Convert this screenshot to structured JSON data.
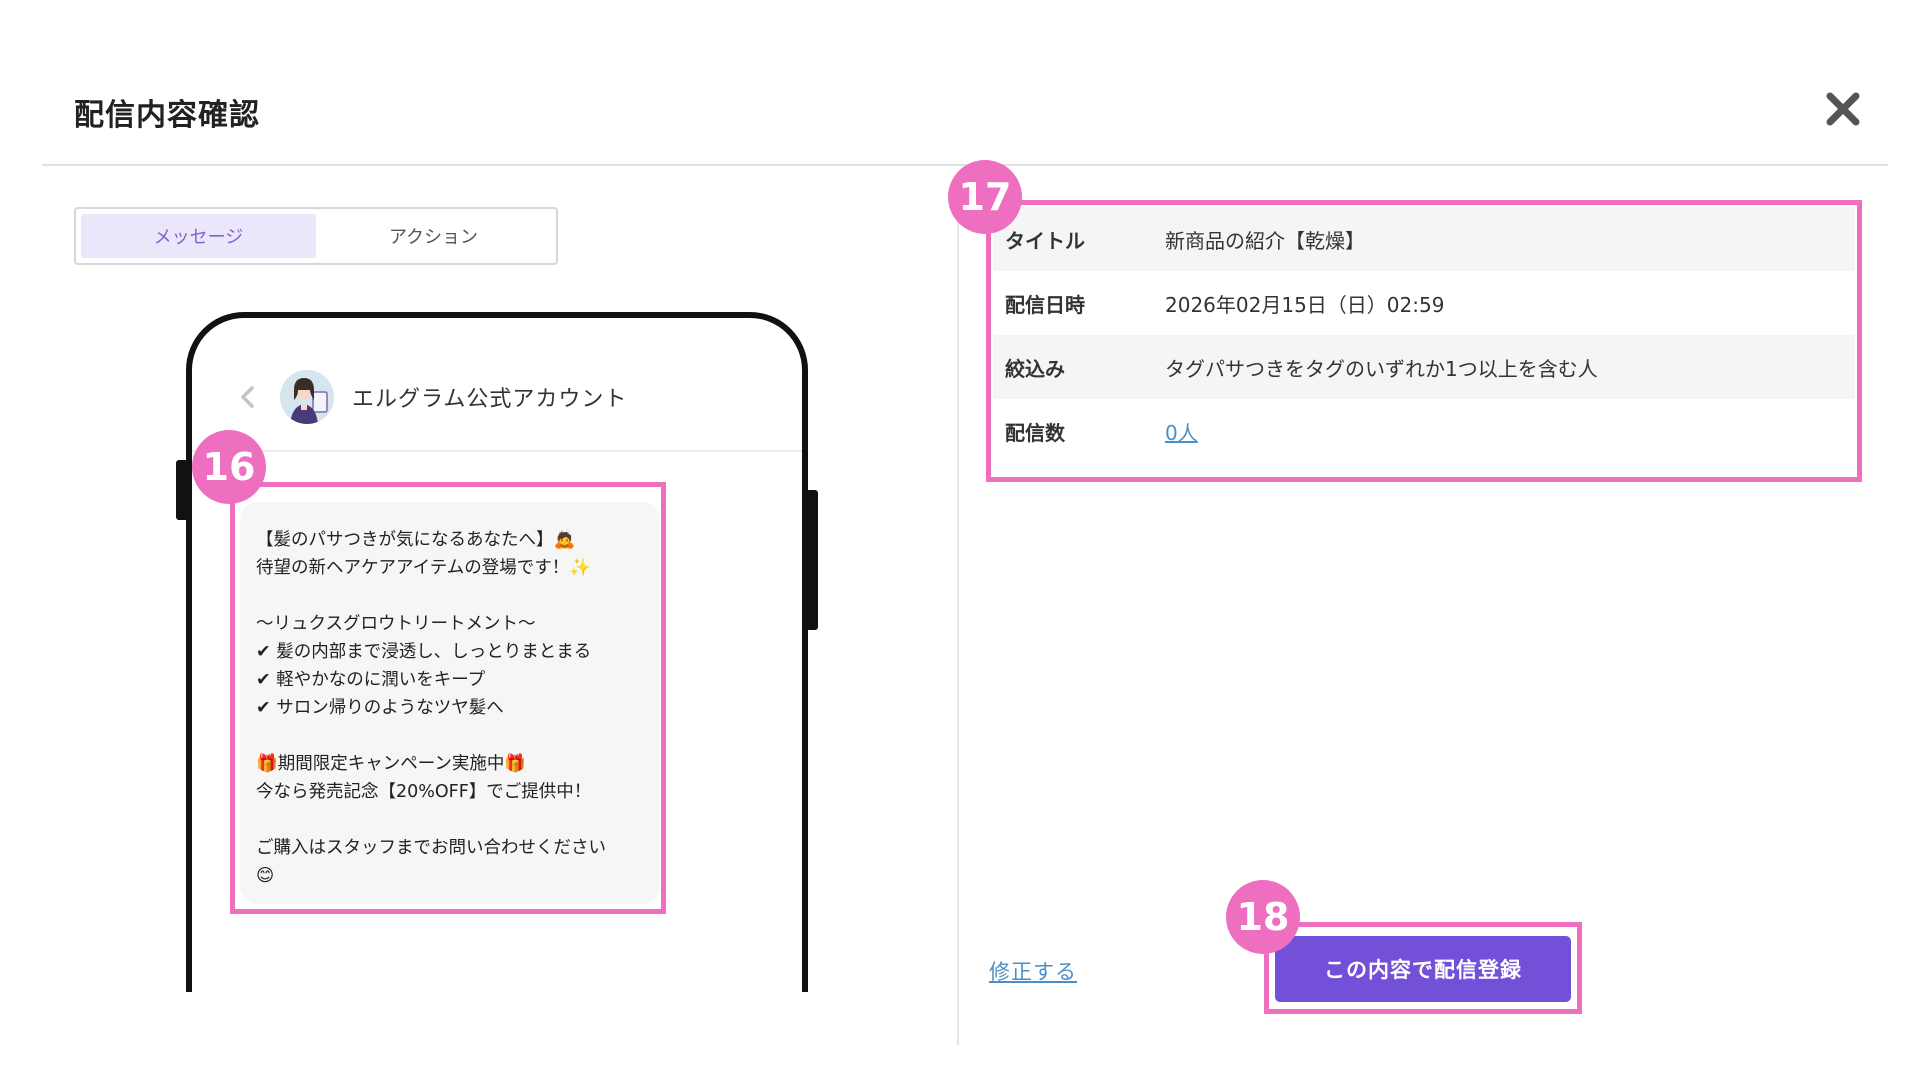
{
  "modal": {
    "title": "配信内容確認"
  },
  "tabs": [
    {
      "label": "メッセージ",
      "active": true
    },
    {
      "label": "アクション",
      "active": false
    }
  ],
  "phone": {
    "account_name": "エルグラム公式アカウント",
    "message_lines": [
      "【髪のパサつきが気になるあなたへ】🙇",
      "待望の新ヘアケアアイテムの登場です！✨",
      "",
      "〜リュクスグロウトリートメント〜",
      "✔ 髪の内部まで浸透し、しっとりまとまる",
      "✔ 軽やかなのに潤いをキープ",
      "✔ サロン帰りのようなツヤ髪へ",
      "",
      "🎁期間限定キャンペーン実施中🎁",
      "今なら発売記念【20%OFF】でご提供中！",
      "",
      "ご購入はスタッフまでお問い合わせください",
      "😊"
    ]
  },
  "info": {
    "rows": [
      {
        "label": "タイトル",
        "value": "新商品の紹介【乾燥】"
      },
      {
        "label": "配信日時",
        "value": "2026年02月15日（日）02:59"
      },
      {
        "label": "絞込み",
        "value": "タグパサつきをタグのいずれか1つ以上を含む人"
      },
      {
        "label": "配信数",
        "value": "0人"
      }
    ]
  },
  "actions": {
    "edit_label": "修正する",
    "submit_label": "この内容で配信登録"
  },
  "annotations": {
    "badge_16": "16",
    "badge_17": "17",
    "badge_18": "18"
  },
  "colors": {
    "accent_purple": "#7350d8",
    "highlight_pink": "#ee6fbf",
    "link_blue": "#4a8fc7",
    "tab_active_bg": "#ece6fb"
  }
}
